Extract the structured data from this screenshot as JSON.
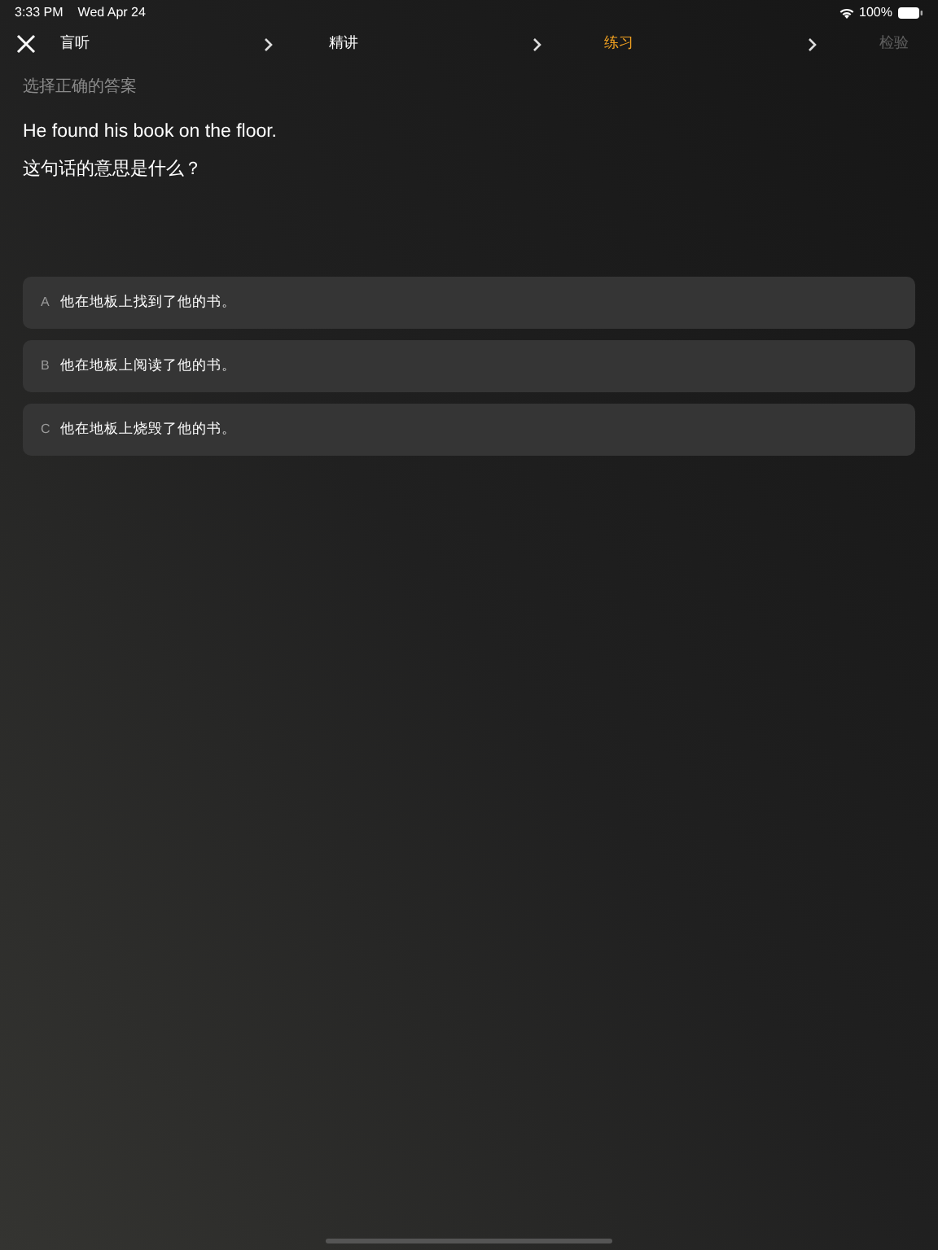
{
  "status_bar": {
    "time": "3:33 PM",
    "date": "Wed Apr 24",
    "battery": "100%"
  },
  "steps": [
    {
      "label": "盲听",
      "selected": false,
      "disabled": false
    },
    {
      "label": "精讲",
      "selected": false,
      "disabled": false
    },
    {
      "label": "练习",
      "selected": true,
      "disabled": false
    },
    {
      "label": "检验",
      "selected": false,
      "disabled": true
    }
  ],
  "instruction": "选择正确的答案",
  "sentence": "He found his book on the floor.",
  "question": "这句话的意思是什么？",
  "options": [
    {
      "letter": "A",
      "text": "他在地板上找到了他的书。"
    },
    {
      "letter": "B",
      "text": "他在地板上阅读了他的书。"
    },
    {
      "letter": "C",
      "text": "他在地板上烧毁了他的书。"
    }
  ]
}
